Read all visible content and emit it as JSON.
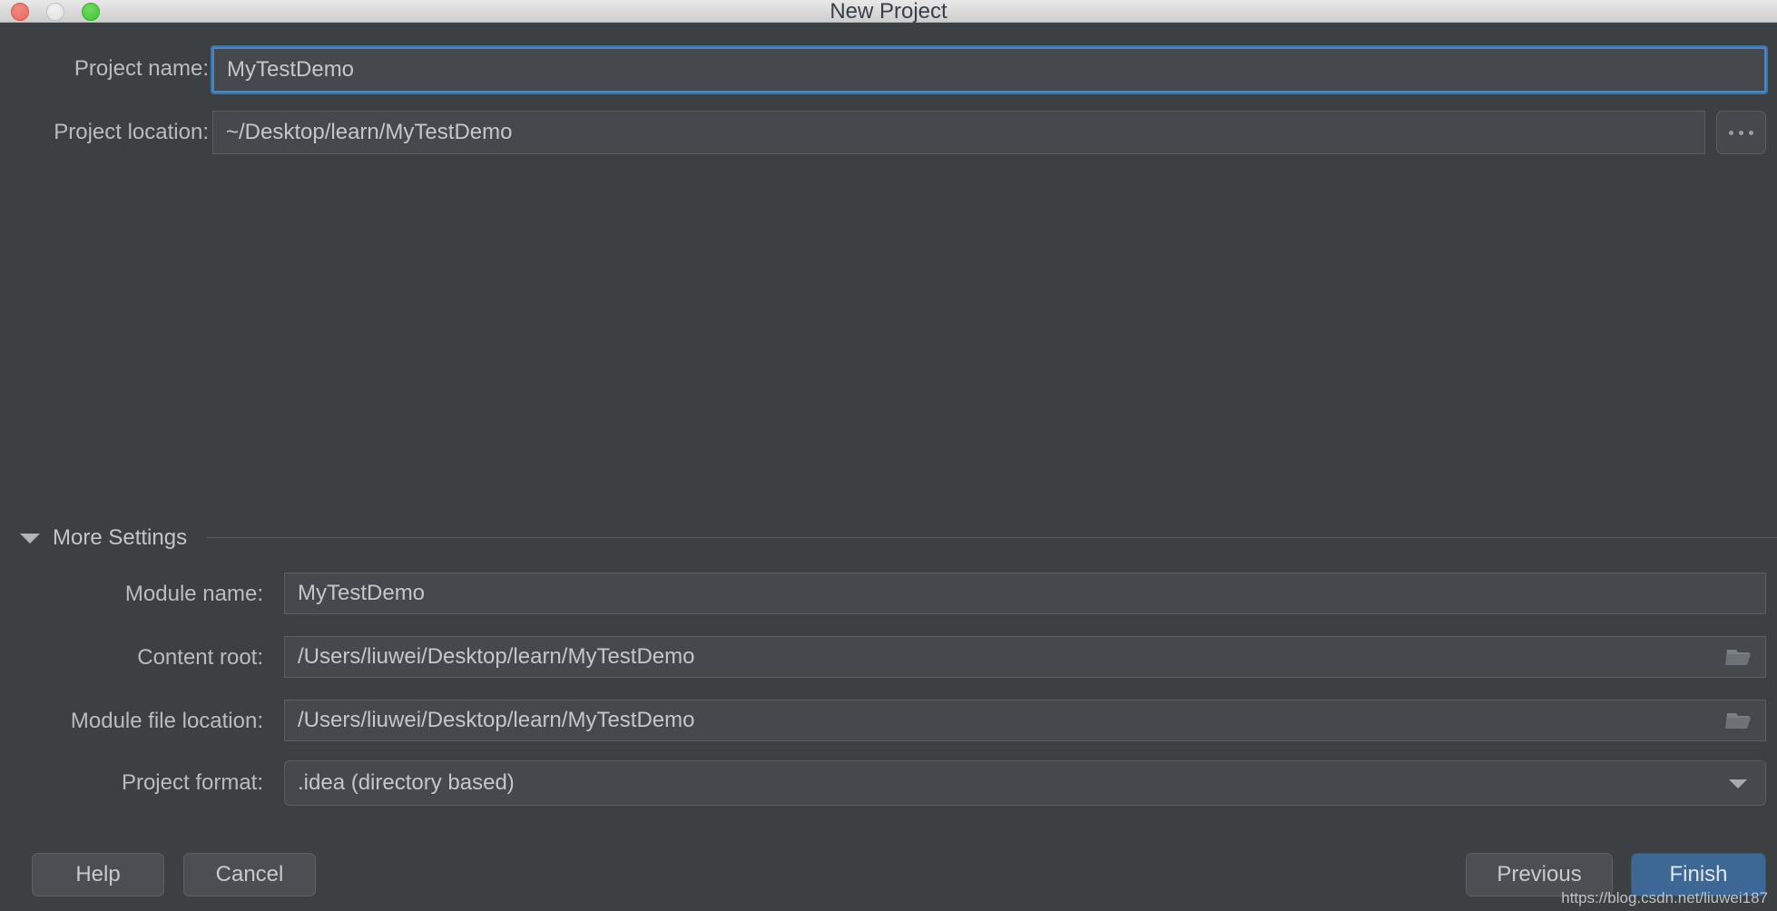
{
  "window": {
    "title": "New Project",
    "controls": {
      "close": "close-button",
      "minimize": "minimize-button",
      "maximize": "maximize-button"
    }
  },
  "form": {
    "project_name": {
      "label": "Project name:",
      "value": "MyTestDemo",
      "focused": true
    },
    "project_location": {
      "label": "Project location:",
      "value": "~/Desktop/learn/MyTestDemo",
      "browse_label": "..."
    }
  },
  "more_settings": {
    "label": "More Settings",
    "expanded": true,
    "module_name": {
      "label": "Module name:",
      "value": "MyTestDemo"
    },
    "content_root": {
      "label": "Content root:",
      "value": "/Users/liuwei/Desktop/learn/MyTestDemo"
    },
    "module_file_location": {
      "label": "Module file location:",
      "value": "/Users/liuwei/Desktop/learn/MyTestDemo"
    },
    "project_format": {
      "label": "Project format:",
      "value": ".idea (directory based)"
    }
  },
  "buttons": {
    "help": "Help",
    "cancel": "Cancel",
    "previous": "Previous",
    "finish": "Finish"
  },
  "watermark": "https://blog.csdn.net/liuwei187",
  "colors": {
    "dialog_bg": "#3c4043",
    "field_bg": "#45494d",
    "accent": "#3d6896",
    "focus_ring": "#4a87c4",
    "text": "#c3c7cb",
    "close_red": "#e8695c",
    "minimize_gray": "#dedede",
    "maximize_green": "#3fc42f"
  }
}
